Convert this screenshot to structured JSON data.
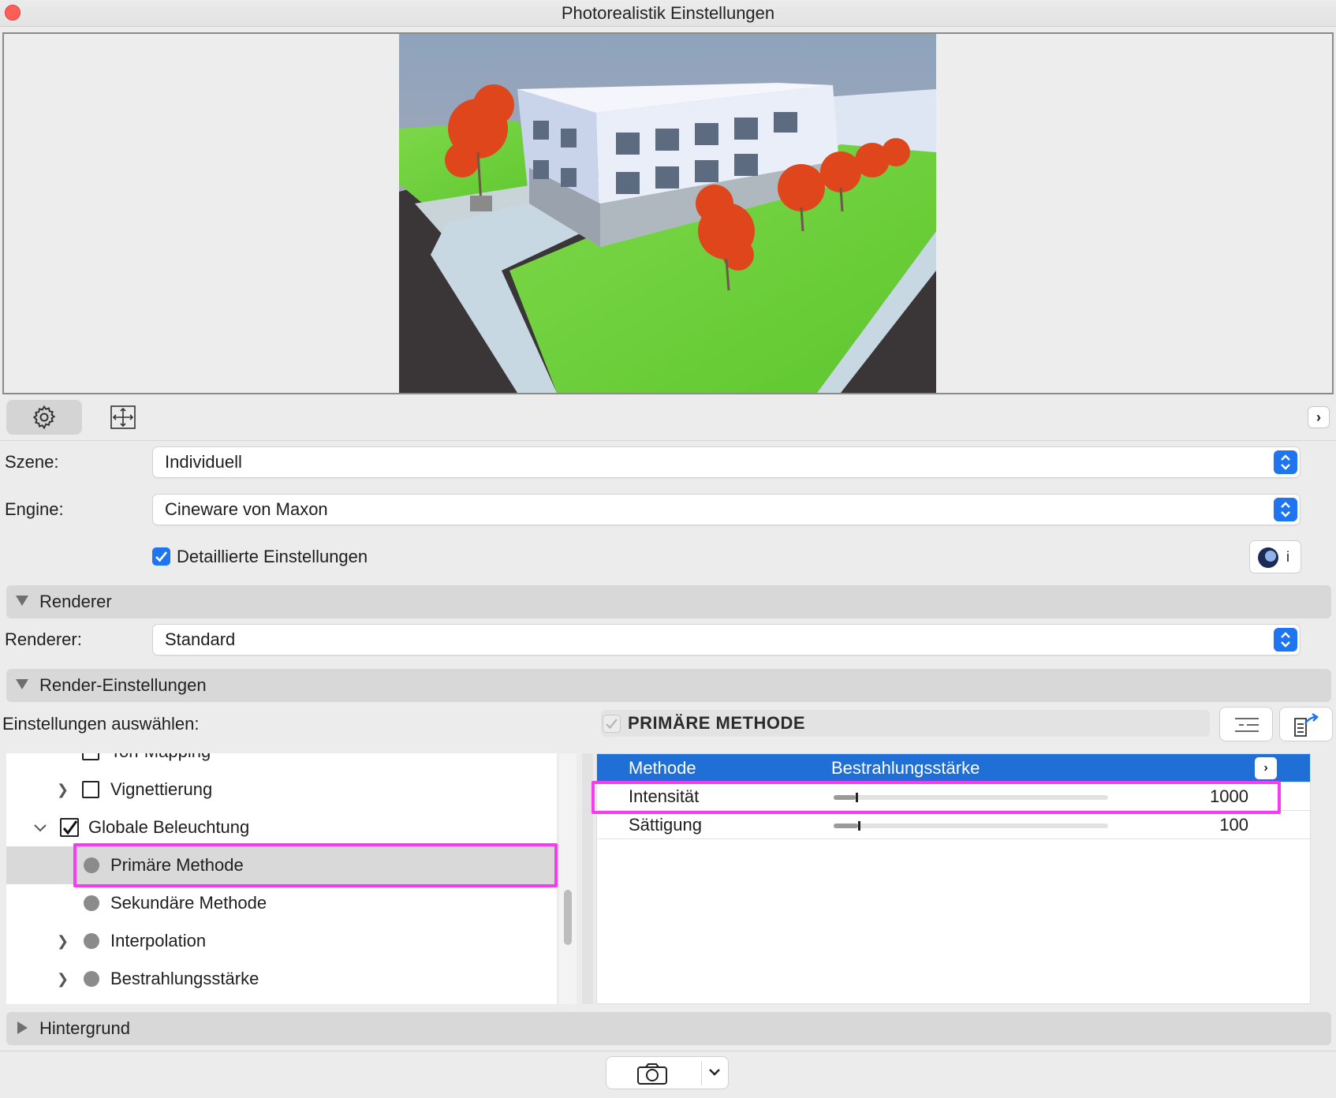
{
  "window": {
    "title": "Photorealistik Einstellungen"
  },
  "toolbar": {
    "tabs": [
      {
        "icon": "gear-icon"
      },
      {
        "icon": "layout-icon"
      }
    ],
    "expand_icon": "chevron-right-icon"
  },
  "form": {
    "scene": {
      "label": "Szene:",
      "value": "Individuell"
    },
    "engine": {
      "label": "Engine:",
      "value": "Cineware von Maxon"
    },
    "detailed": {
      "label": "Detaillierte Einstellungen",
      "checked": true
    },
    "info_label": "i"
  },
  "sections": {
    "renderer": {
      "label": "Renderer",
      "expanded": true
    },
    "render_settings": {
      "label": "Render-Einstellungen",
      "expanded": true
    },
    "background": {
      "label": "Hintergrund",
      "expanded": false
    }
  },
  "renderer_select": {
    "label": "Renderer:",
    "value": "Standard"
  },
  "settings": {
    "choose_label": "Einstellungen auswählen:",
    "current_title": "PRIMÄRE METHODE",
    "tree": [
      {
        "label": "Ton-Mapping",
        "type": "checkbox",
        "checked": false
      },
      {
        "label": "Vignettierung",
        "type": "checkbox",
        "checked": false,
        "expandable": true
      },
      {
        "label": "Globale Beleuchtung",
        "type": "checkbox",
        "checked": true,
        "expanded": true
      },
      {
        "label": "Primäre Methode",
        "type": "dot",
        "selected": true
      },
      {
        "label": "Sekundäre Methode",
        "type": "dot"
      },
      {
        "label": "Interpolation",
        "type": "dot",
        "expandable": true
      },
      {
        "label": "Bestrahlungsstärke",
        "type": "dot",
        "expandable": true
      }
    ],
    "properties": [
      {
        "name": "Methode",
        "value": "Bestrahlungsstärke",
        "selected": true
      },
      {
        "name": "Intensität",
        "value": "1000",
        "slider_fraction": 0.08
      },
      {
        "name": "Sättigung",
        "value": "100",
        "slider_fraction": 0.09
      }
    ]
  },
  "colors": {
    "accent": "#1f74f0",
    "highlight": "#f63cf0",
    "close": "#fe5f57"
  }
}
